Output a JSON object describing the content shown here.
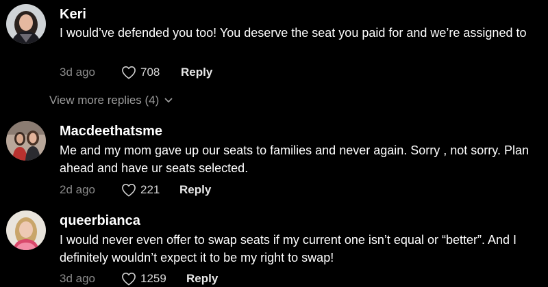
{
  "colors": {
    "background": "#000000",
    "text": "#ffffff",
    "muted": "#8a8a8a"
  },
  "comments": [
    {
      "username": "Keri",
      "text": "I would’ve defended you too! You deserve the seat you paid for and we’re assigned to",
      "time": "3d ago",
      "likes": "708",
      "reply_label": "Reply",
      "like_icon": "heart-outline-icon",
      "view_more": "View more replies (4)",
      "view_more_icon": "chevron-down-icon"
    },
    {
      "username": "Macdeethatsme",
      "text": "Me and my mom gave up our seats to families and never again. Sorry , not sorry. Plan ahead and have ur seats selected.",
      "time": "2d ago",
      "likes": "221",
      "reply_label": "Reply",
      "like_icon": "heart-outline-icon"
    },
    {
      "username": "queerbianca",
      "text": "I would never even offer to swap seats if my current one isn’t equal or “better”. And I definitely wouldn’t expect it to be my right to swap!",
      "time": "3d ago",
      "likes": "1259",
      "reply_label": "Reply",
      "like_icon": "heart-outline-icon"
    }
  ]
}
